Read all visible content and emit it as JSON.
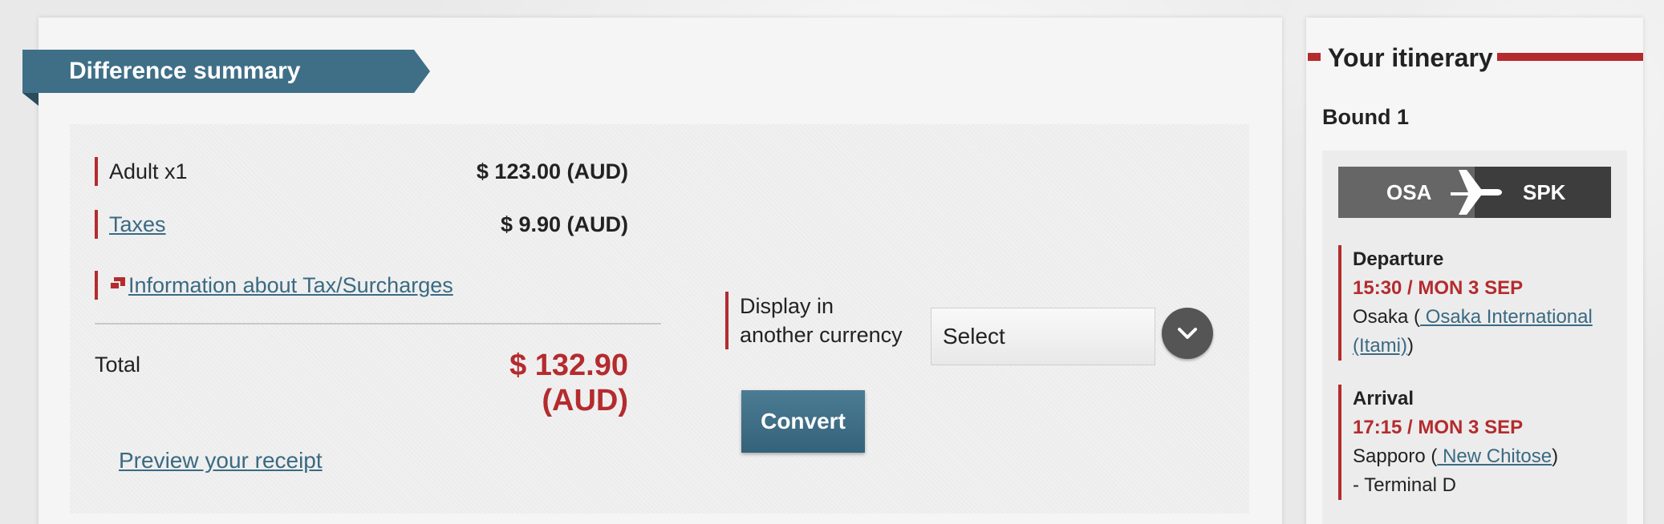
{
  "difference_summary": {
    "title": "Difference summary",
    "adult_label": "Adult x1",
    "adult_value": "$ 123.00 (AUD)",
    "taxes_label": "Taxes",
    "taxes_value": "$ 9.90 (AUD)",
    "info_link": "Information about Tax/Surcharges",
    "total_label": "Total",
    "total_value": "$ 132.90 (AUD)",
    "preview_link": "Preview your receipt"
  },
  "currency": {
    "label_line1": "Display in",
    "label_line2": "another currency",
    "select_value": "Select",
    "convert_label": "Convert"
  },
  "itinerary": {
    "title": "Your itinerary",
    "bound_title": "Bound 1",
    "route_from": "OSA",
    "route_to": "SPK",
    "departure": {
      "title": "Departure",
      "time": "15:30 / MON 3 SEP",
      "city": "Osaka (",
      "airport_link": " Osaka International (Itami)",
      "close": ")"
    },
    "arrival": {
      "title": "Arrival",
      "time": "17:15 / MON 3 SEP",
      "city": "Sapporo (",
      "airport_link": " New Chitose",
      "close": ")",
      "terminal": "- Terminal  D"
    }
  },
  "colors": {
    "accent_red": "#b42b2e",
    "ribbon_blue": "#3f6f87",
    "link_blue": "#3a6a82"
  }
}
